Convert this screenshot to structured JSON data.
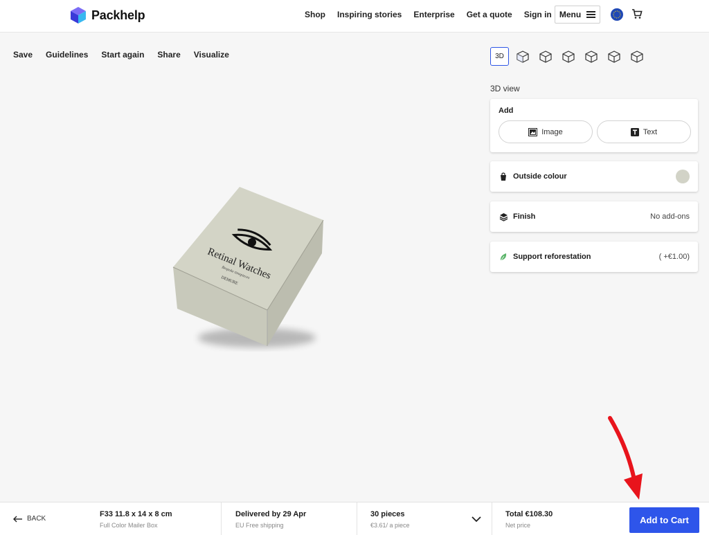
{
  "brand": {
    "name": "Packhelp",
    "accent": "#2e55ea"
  },
  "nav": {
    "links": [
      "Shop",
      "Inspiring stories",
      "Enterprise",
      "Get a quote",
      "Sign in"
    ],
    "menu_label": "Menu",
    "icons": [
      "eu-flag-icon",
      "cart-icon"
    ]
  },
  "toolbar": {
    "items": [
      "Save",
      "Guidelines",
      "Start again",
      "Share",
      "Visualize"
    ]
  },
  "views": {
    "active_label": "3D",
    "current_view": "3D view"
  },
  "panel": {
    "add": {
      "title": "Add",
      "image_label": "Image",
      "text_label": "Text"
    },
    "outside_colour": {
      "label": "Outside colour",
      "swatch": "#d2d3c7"
    },
    "finish": {
      "label": "Finish",
      "value": "No add-ons"
    },
    "reforestation": {
      "label": "Support reforestation",
      "value": "( +€1.00)"
    }
  },
  "box_print": {
    "brand": "Retinal Watches",
    "tagline": "Bespoke timepieces",
    "sub": "DEMURE"
  },
  "bottom": {
    "back_label": "BACK",
    "product": {
      "title": "F33 11.8 x 14 x 8 cm",
      "subtitle": "Full Color Mailer Box"
    },
    "delivery": {
      "title": "Delivered by 29 Apr",
      "subtitle": "EU Free shipping"
    },
    "quantity": {
      "title": "30 pieces",
      "subtitle": "€3.61/ a piece"
    },
    "total": {
      "title": "Total €108.30",
      "subtitle": "Net price"
    },
    "cta_label": "Add to Cart"
  }
}
